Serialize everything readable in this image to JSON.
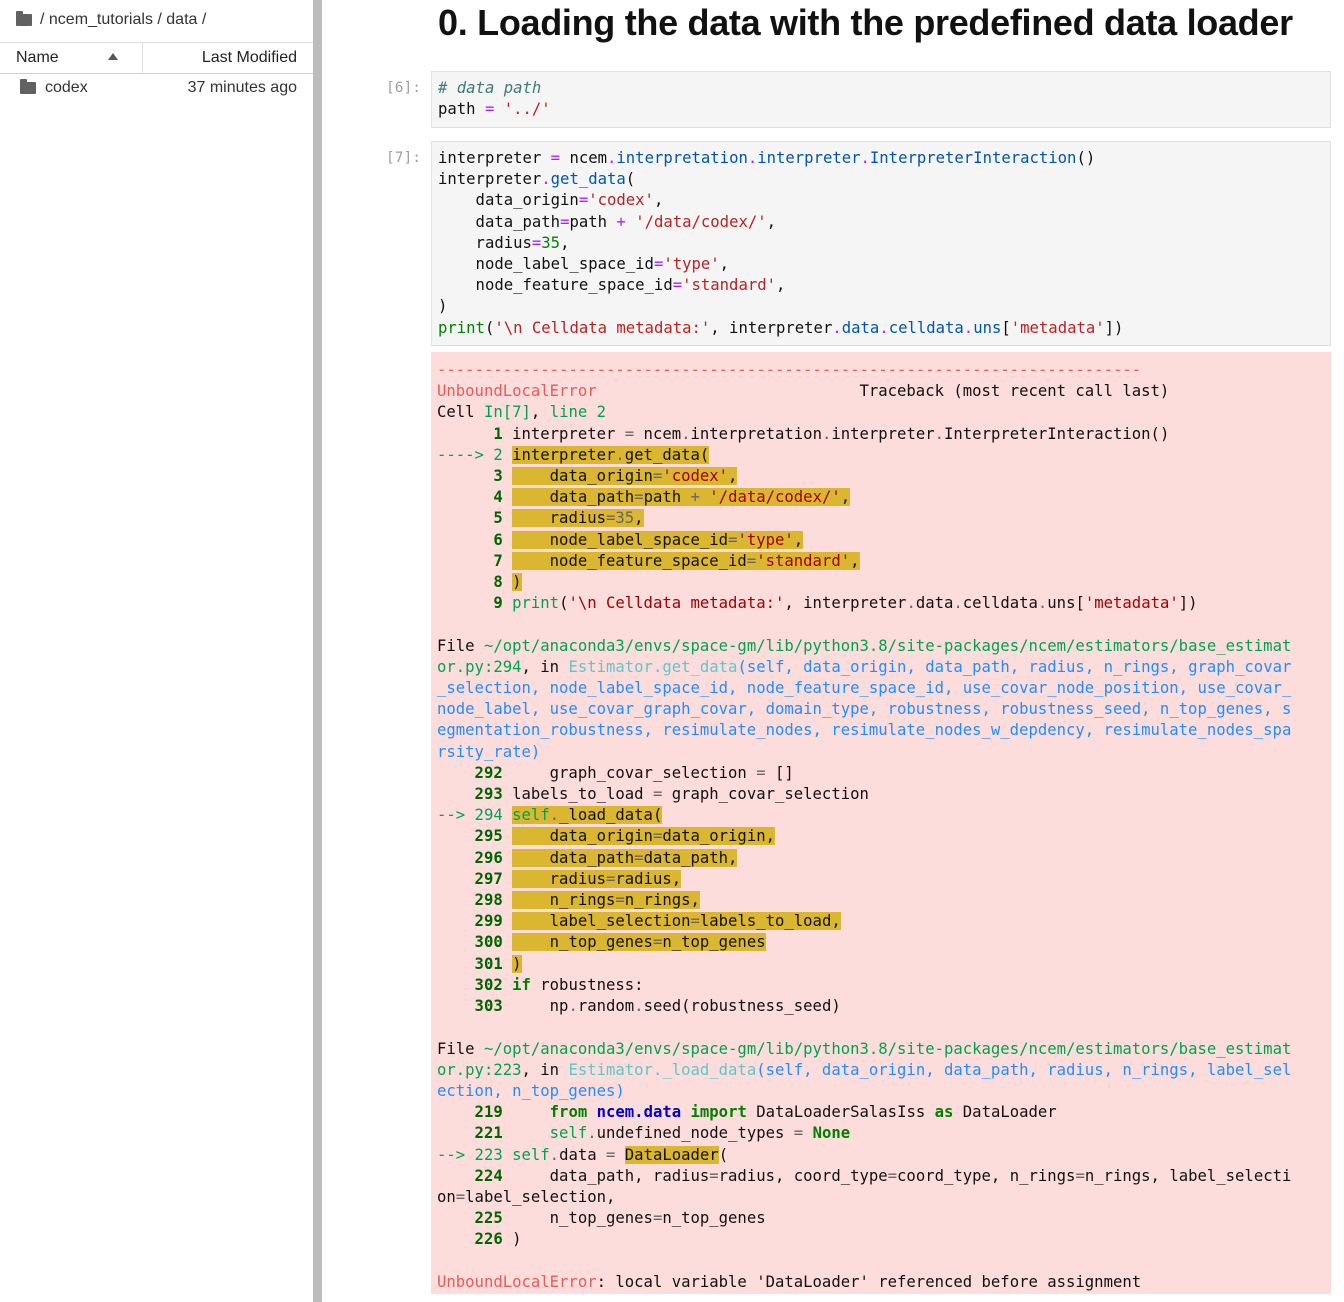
{
  "sidebar": {
    "breadcrumb": "/ ncem_tutorials / data /",
    "columns": {
      "name": "Name",
      "modified": "Last Modified"
    },
    "files": [
      {
        "name": "codex",
        "modified": "37 minutes ago"
      }
    ]
  },
  "notebook": {
    "heading": "0. Loading the data with the predefined data loader",
    "cells": [
      {
        "prompt": "[6]:",
        "code": "# data path\npath = '../'"
      },
      {
        "prompt": "[7]:",
        "code": "interpreter = ncem.interpretation.interpreter.InterpreterInteraction()\ninterpreter.get_data(\n    data_origin='codex',\n    data_path=path + '/data/codex/',\n    radius=35,\n    node_label_space_id='type',\n    node_feature_space_id='standard',\n)\nprint('\\n Celldata metadata:', interpreter.data.celldata.uns['metadata'])"
      }
    ],
    "error_output": {
      "rule": "---------------------------------------------------------------------------",
      "error_name": "UnboundLocalError",
      "traceback_label": "Traceback (most recent call last)",
      "cell_ref": "Cell In[7], line 2",
      "frame1_lines": [
        "1 interpreter = ncem.interpretation.interpreter.InterpreterInteraction()",
        "----> 2 interpreter.get_data(",
        "3     data_origin='codex',",
        "4     data_path=path + '/data/codex/',",
        "5     radius=35,",
        "6     node_label_space_id='type',",
        "7     node_feature_space_id='standard',",
        "8 )",
        "9 print('\\n Celldata metadata:', interpreter.data.celldata.uns['metadata'])"
      ],
      "frame2_header": "File ~/opt/anaconda3/envs/space-gm/lib/python3.8/site-packages/ncem/estimators/base_estimator.py:294, in Estimator.get_data(self, data_origin, data_path, radius, n_rings, graph_covar_selection, node_label_space_id, node_feature_space_id, use_covar_node_position, use_covar_node_label, use_covar_graph_covar, domain_type, robustness, robustness_seed, n_top_genes, segmentation_robustness, resimulate_nodes, resimulate_nodes_w_depdency, resimulate_nodes_sparsity_rate)",
      "frame3_header": "File ~/opt/anaconda3/envs/space-gm/lib/python3.8/site-packages/ncem/estimators/base_estimator.py:223, in Estimator._load_data(self, data_origin, data_path, radius, n_rings, label_selection, n_top_genes)",
      "final_message": "UnboundLocalError: local variable 'DataLoader' referenced before assignment"
    }
  }
}
